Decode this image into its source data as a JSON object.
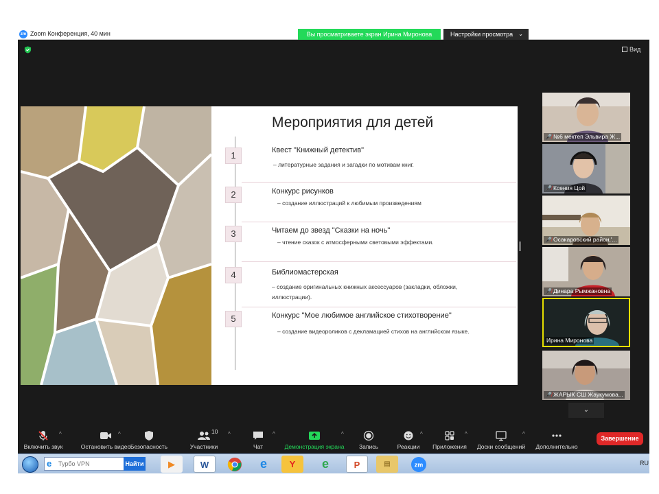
{
  "titlebar": {
    "app_title": "Zoom Конференция, 40 мин",
    "share_banner": "Вы просматриваете экран Ирина Миронова",
    "view_options": "Настройки просмотра",
    "app_icon_text": "zm"
  },
  "topbar": {
    "view_label": "Вид"
  },
  "slide": {
    "title": "Мероприятия для детей",
    "steps": [
      {
        "num": "1",
        "head": "Квест \"Книжный детектив\"",
        "desc": "– литературные задания и загадки по мотивам книг."
      },
      {
        "num": "2",
        "head": "Конкурс рисунков",
        "desc": "– создание иллюстраций к любимым произведениям"
      },
      {
        "num": "3",
        "head": "Читаем до звезд \"Сказки на ночь\"",
        "desc": "– чтение сказок с атмосферными световыми эффектами."
      },
      {
        "num": "4",
        "head": "Библиомастерская",
        "desc": "– создание оригинальных книжных аксессуаров (закладки, обложки, иллюстрации)."
      },
      {
        "num": "5",
        "head": "Конкурс \"Мое любимое английское стихотворение\"",
        "desc": "– создание видеороликов с декламацией стихов на английском языке."
      }
    ]
  },
  "participants": [
    {
      "name": "№6 мектеп Эльвира Ж...",
      "muted": true,
      "bg": "#cbb9a8"
    },
    {
      "name": "Ксения Цой",
      "muted": true,
      "bg": "#8a8f98"
    },
    {
      "name": "Осакаровский район,'...",
      "muted": true,
      "bg": "#b7ab96"
    },
    {
      "name": "Динара Рымжановна",
      "muted": true,
      "bg": "#a39385"
    },
    {
      "name": "Ирина Миронова",
      "muted": false,
      "bg": "#1f2a2a"
    },
    {
      "name": "ЖАРЫК СШ Жаукумова...",
      "muted": true,
      "bg": "#9a8f8a"
    }
  ],
  "toolbar": {
    "mute": "Включить звук",
    "video": "Остановить видео",
    "security": "Безопасность",
    "participants": "Участники",
    "participants_count": "10",
    "chat": "Чат",
    "share": "Демонстрация экрана",
    "record": "Запись",
    "reactions": "Реакции",
    "apps": "Приложения",
    "whiteboards": "Доски сообщений",
    "more": "Дополнительно",
    "end": "Завершение"
  },
  "taskbar": {
    "search_placeholder": "Турбо VPN",
    "search_go": "Найти",
    "tray": "RU",
    "apps": [
      "vlc-app",
      "word-app",
      "chrome-app",
      "ie-app",
      "yandex-app",
      "edge-app",
      "powerpoint-app",
      "explorer-app",
      "zoom-app"
    ]
  },
  "colors": {
    "accent_green": "#23d959",
    "end_red": "#e02828",
    "active_speaker": "#e7e000",
    "zoom_blue": "#2d8cff"
  }
}
